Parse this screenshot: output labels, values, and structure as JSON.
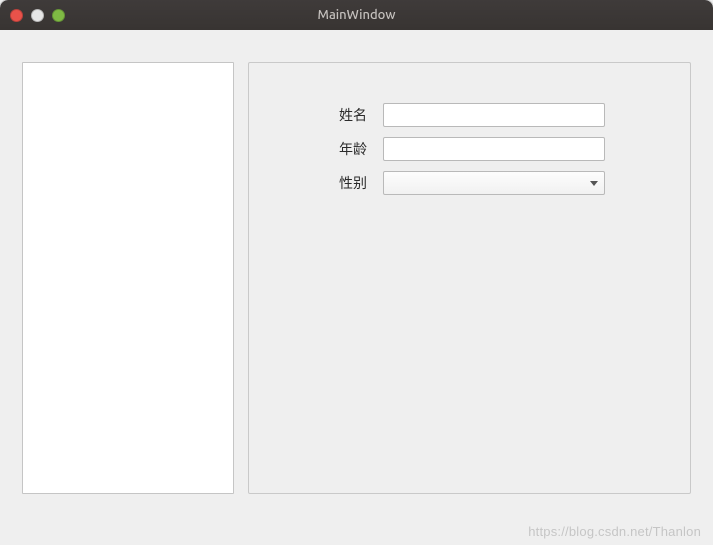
{
  "window": {
    "title": "MainWindow"
  },
  "form": {
    "name_label": "姓名",
    "name_value": "",
    "age_label": "年龄",
    "age_value": "",
    "gender_label": "性别",
    "gender_value": ""
  },
  "watermark": "https://blog.csdn.net/Thanlon"
}
